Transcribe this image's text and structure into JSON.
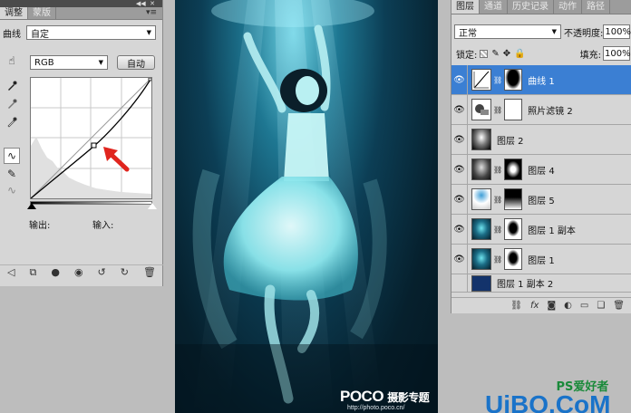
{
  "adjustments_panel": {
    "tabs": [
      "调整",
      "蒙版"
    ],
    "preset_label": "曲线",
    "preset_value": "自定",
    "channel_value": "RGB",
    "auto_button": "自动",
    "output_label": "输出:",
    "input_label": "输入:"
  },
  "photo": {
    "brand": "POCO",
    "caption": "摄影专题",
    "url": "http://photo.poco.cn/"
  },
  "layers_panel": {
    "tabs": [
      "图层",
      "通道",
      "历史记录",
      "动作",
      "路径"
    ],
    "blend_mode": "正常",
    "opacity_label": "不透明度:",
    "opacity_value": "100%",
    "lock_label": "锁定:",
    "fill_label": "填充:",
    "fill_value": "100%",
    "layers": [
      {
        "name": "曲线 1"
      },
      {
        "name": "照片滤镜 2"
      },
      {
        "name": "图层 2"
      },
      {
        "name": "图层 4"
      },
      {
        "name": "图层 5"
      },
      {
        "name": "图层 1 副本"
      },
      {
        "name": "图层 1"
      },
      {
        "name": "图层 1 副本 2"
      }
    ]
  },
  "watermark": {
    "site": "UiBQ.CoM",
    "ps_text": "PS爱好者"
  },
  "colors": {
    "selection": "#3b7fd3",
    "arrow": "#e0251e",
    "water": "#0c3e55",
    "panel": "#d6d6d6"
  }
}
